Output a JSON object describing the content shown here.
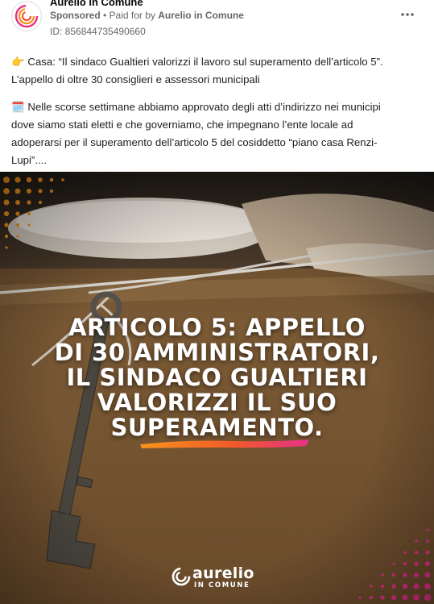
{
  "header": {
    "page_name": "Aurelio in Comune",
    "sponsored": "Sponsored",
    "separator": " • ",
    "paid_for_prefix": "Paid for by ",
    "paid_for_name": "Aurelio in Comune",
    "ad_id": "ID: 856844735490660",
    "more_icon": "more-horizontal-icon"
  },
  "body": {
    "para1_emoji": "👉",
    "para1_line1": "Casa: “Il sindaco Gualtieri valorizzi il lavoro sul superamento dell’articolo 5”.",
    "para1_line2": "L’appello di oltre 30 consiglieri e assessori municipali",
    "para2_emoji": "🗓️",
    "para2_line1": "Nelle scorse settimane abbiamo approvato degli atti d’indirizzo nei municipi",
    "para2_line2": "dove siamo stati eletti e che governiamo, che impegnano l’ente locale ad",
    "para2_line3": "adoperarsi per il superamento dell’articolo 5 del cosiddetto “piano casa Renzi-",
    "para2_line4": "Lupi”...."
  },
  "ad_image": {
    "headline_lines": [
      "ARTICOLO 5: APPELLO",
      "DI 30 AMMINISTRATORI,",
      "IL SINDACO GUALTIERI",
      "VALORIZZI IL SUO",
      "SUPERAMENTO."
    ],
    "logo_word": "aurelio",
    "logo_sub": "IN COMUNE",
    "accent_colors": [
      "#f7941d",
      "#e8308a",
      "#ffffff"
    ]
  }
}
